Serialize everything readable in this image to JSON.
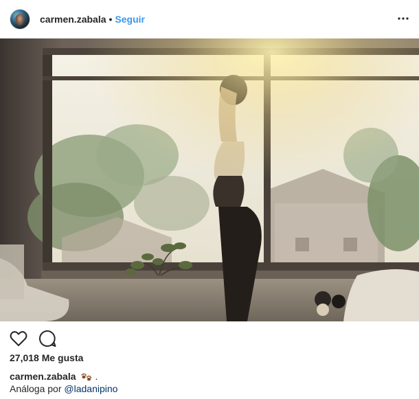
{
  "header": {
    "username": "carmen.zabala",
    "separator": "•",
    "follow_label": "Seguir",
    "more_icon": "more-horizontal-icon",
    "more_label": "•••"
  },
  "photo": {
    "description_icon": "post-photo"
  },
  "actions": {
    "like_icon": "heart-icon",
    "comment_icon": "comment-icon"
  },
  "likes": {
    "text": "27,018 Me gusta"
  },
  "caption": {
    "username": "carmen.zabala",
    "emoji_icon": "paw-prints-icon",
    "tail": ".",
    "line2_prefix": "Análoga por ",
    "mention": "@ladanipino"
  },
  "colors": {
    "link": "#3897f0",
    "mention": "#003569",
    "text": "#262626"
  }
}
